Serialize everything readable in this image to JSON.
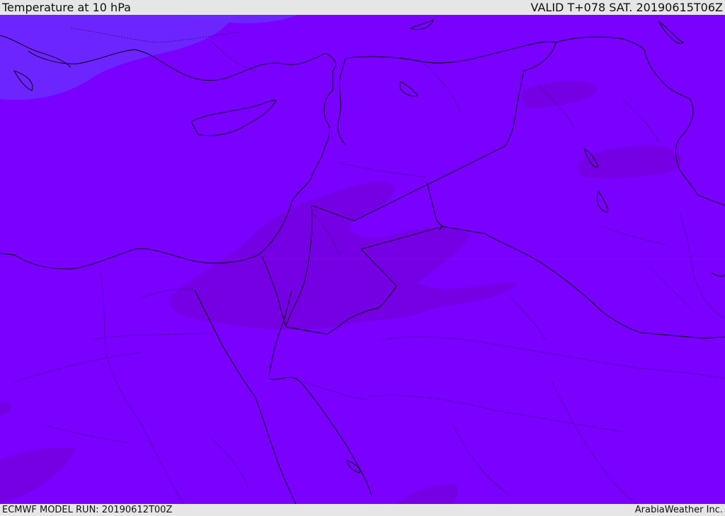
{
  "header": {
    "title": "Temperature at 10 hPa",
    "valid_time": "VALID T+078 SAT. 20190615T06Z"
  },
  "footer": {
    "model_run": "ECMWF MODEL RUN: 20190612T00Z",
    "credit": "ArabiaWeather Inc."
  },
  "colors": {
    "field_base": "#7a00ff",
    "field_cooler": "#6a2cff",
    "field_warmer": "#7400e0",
    "boundary": "#000000",
    "bar_background": "#e6e6e6"
  }
}
